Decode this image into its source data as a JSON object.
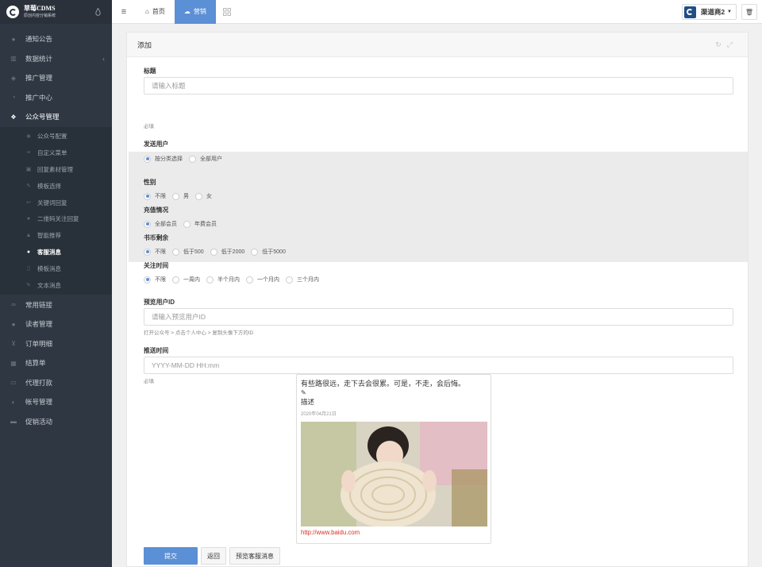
{
  "brand": {
    "name": "草莓CDMS",
    "subtitle": "原创内容分销系统"
  },
  "sidebar": {
    "items": [
      {
        "label": "通知公告",
        "icon": "comment-icon"
      },
      {
        "label": "数据统计",
        "icon": "bar-chart-icon"
      },
      {
        "label": "推广管理",
        "icon": "tags-icon"
      },
      {
        "label": "推广中心",
        "icon": "user-circle-icon"
      },
      {
        "label": "公众号管理",
        "icon": "wechat-icon"
      }
    ],
    "sub_items": [
      {
        "label": "公众号配置",
        "icon": "wechat-icon"
      },
      {
        "label": "自定义菜单",
        "icon": "list-icon"
      },
      {
        "label": "回复素材管理",
        "icon": "image-icon"
      },
      {
        "label": "模板选择",
        "icon": "pencil-icon"
      },
      {
        "label": "关键词回复",
        "icon": "reply-icon"
      },
      {
        "label": "二维码关注回复",
        "icon": "comment-icon"
      },
      {
        "label": "智能推荐",
        "icon": "thumbs-up-icon"
      },
      {
        "label": "客服消息",
        "icon": "user-icon"
      },
      {
        "label": "模板消息",
        "icon": "file-icon"
      },
      {
        "label": "文本消息",
        "icon": "edit-icon"
      }
    ],
    "items_after": [
      {
        "label": "常用链接",
        "icon": "link-icon"
      },
      {
        "label": "读者管理",
        "icon": "user-icon"
      },
      {
        "label": "订单明细",
        "icon": "cart-icon"
      },
      {
        "label": "结算单",
        "icon": "calculator-icon"
      },
      {
        "label": "代理打款",
        "icon": "money-icon"
      },
      {
        "label": "帐号管理",
        "icon": "user-md-icon"
      },
      {
        "label": "促销活动",
        "icon": "briefcase-icon"
      }
    ]
  },
  "topbar": {
    "tabs": [
      {
        "label": "首页",
        "icon": "home-icon"
      },
      {
        "label": "营销",
        "icon": "cloud-icon"
      }
    ],
    "dealer": "渠道商2"
  },
  "panel": {
    "title": "添加"
  },
  "form": {
    "title": {
      "label": "标题",
      "placeholder": "请输入标题",
      "help": "必填"
    },
    "send_users": {
      "label": "发送用户",
      "options": [
        "按分类选择",
        "全部用户"
      ],
      "selected": "按分类选择"
    },
    "gender": {
      "label": "性别",
      "options": [
        "不限",
        "男",
        "女"
      ],
      "selected": "不限"
    },
    "recharge": {
      "label": "充值情况",
      "options": [
        "全部会员",
        "年费会员"
      ],
      "selected": "全部会员"
    },
    "coins": {
      "label": "书币剩余",
      "options": [
        "不限",
        "低于500",
        "低于2000",
        "低于5000"
      ],
      "selected": "不限"
    },
    "follow_time": {
      "label": "关注时间",
      "options": [
        "不限",
        "一周内",
        "半个月内",
        "一个月内",
        "三个月内"
      ],
      "selected": "不限"
    },
    "preview_user": {
      "label": "预览用户ID",
      "placeholder": "请输入预览用户ID",
      "help": "打开公众号 > 点击个人中心 > 复制头像下方的ID"
    },
    "push_time": {
      "label": "推送时间",
      "placeholder": "YYYY-MM-DD HH:mm",
      "help": "必填"
    }
  },
  "preview_card": {
    "title": "有些路很远，走下去会很累。可是，不走，会后悔。",
    "desc": "描述",
    "date": "2020年04月21日",
    "link": "http://www.baidu.com"
  },
  "buttons": {
    "submit": "提交",
    "back": "返回",
    "preview": "预览客服消息"
  }
}
